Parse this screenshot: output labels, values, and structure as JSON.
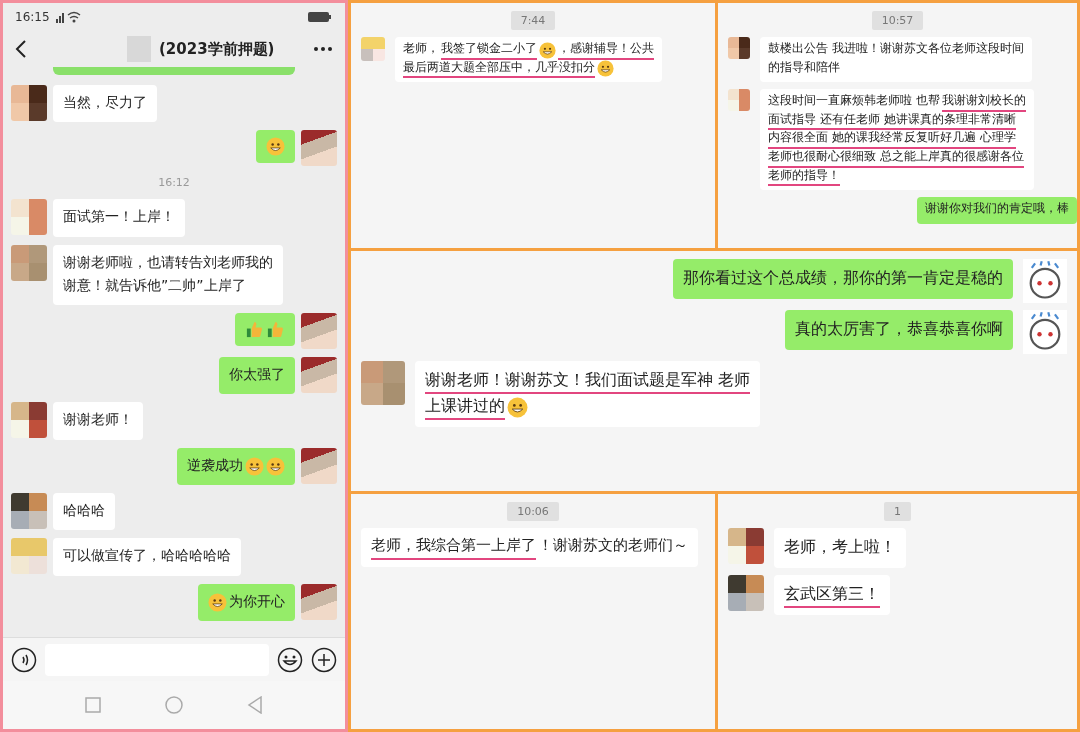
{
  "phone": {
    "status_time": "16:15",
    "title": "(2023学前押题)",
    "messages": [
      {
        "kind": "in",
        "lines": [
          [
            {
              "kind": "text",
              "text": "当然，尽力了",
              "underlined": false
            }
          ]
        ]
      },
      {
        "kind": "out",
        "lines": [
          [
            {
              "kind": "emoji"
            }
          ]
        ]
      },
      {
        "kind": "time",
        "text": "16:12"
      },
      {
        "kind": "in",
        "lines": [
          [
            {
              "kind": "text",
              "text": "面试第一！上岸！",
              "underlined": false
            }
          ]
        ]
      },
      {
        "kind": "in",
        "lines": [
          [
            {
              "kind": "text",
              "text": "谢谢老师啦，也请转告刘老师我的",
              "underlined": false
            }
          ],
          [
            {
              "kind": "text",
              "text": "谢意！就告诉他”二帅”上岸了",
              "underlined": false
            }
          ]
        ]
      },
      {
        "kind": "out",
        "lines": [
          [
            {
              "kind": "thumb"
            },
            {
              "kind": "thumb"
            }
          ]
        ]
      },
      {
        "kind": "out",
        "lines": [
          [
            {
              "kind": "text",
              "text": "你太强了",
              "underlined": false
            }
          ]
        ]
      },
      {
        "kind": "in",
        "lines": [
          [
            {
              "kind": "text",
              "text": "谢谢老师！",
              "underlined": false
            }
          ]
        ]
      },
      {
        "kind": "out",
        "lines": [
          [
            {
              "kind": "text",
              "text": "逆袭成功",
              "underlined": false
            },
            {
              "kind": "emoji"
            },
            {
              "kind": "emoji"
            }
          ]
        ]
      },
      {
        "kind": "in",
        "lines": [
          [
            {
              "kind": "text",
              "text": "哈哈哈",
              "underlined": false
            }
          ]
        ]
      },
      {
        "kind": "in",
        "lines": [
          [
            {
              "kind": "text",
              "text": "可以做宣传了，哈哈哈哈哈",
              "underlined": false
            }
          ]
        ]
      },
      {
        "kind": "out",
        "lines": [
          [
            {
              "kind": "emoji"
            },
            {
              "kind": "text",
              "text": "为你开心",
              "underlined": false
            }
          ]
        ]
      }
    ]
  },
  "panels": [
    {
      "time": "7:44",
      "messages": [
        {
          "kind": "in",
          "avatar": true,
          "lines": [
            [
              {
                "kind": "text",
                "text": "老师，",
                "underlined": false
              },
              {
                "kind": "text",
                "text": "我签了锁金二小了",
                "underlined": true
              },
              {
                "kind": "emoji"
              },
              {
                "kind": "text",
                "text": "，感谢辅导！公共",
                "underlined": true
              }
            ],
            [
              {
                "kind": "text",
                "text": "最后两道大题全部压中，几乎没扣分",
                "underlined": true
              },
              {
                "kind": "emoji"
              }
            ]
          ]
        }
      ]
    },
    {
      "time": "10:57",
      "messages": [
        {
          "kind": "in",
          "avatar": true,
          "lines": [
            [
              {
                "kind": "text",
                "text": "鼓楼出公告 我进啦！谢谢苏文各位老师这段时间",
                "underlined": false
              }
            ],
            [
              {
                "kind": "text",
                "text": "的指导和陪伴",
                "underlined": false
              }
            ]
          ]
        },
        {
          "kind": "in",
          "avatar": true,
          "lines": [
            [
              {
                "kind": "text",
                "text": "这段时间一直麻烦韩老师啦 也帮",
                "underlined": false
              },
              {
                "kind": "text",
                "text": "我谢谢刘校长的",
                "underlined": true
              }
            ],
            [
              {
                "kind": "text",
                "text": "面试指导 还有任老师 她讲课真的条理非常清晰",
                "underlined": true
              }
            ],
            [
              {
                "kind": "text",
                "text": "内容很全面 她的课我经常反复听好几遍 心理学",
                "underlined": true
              }
            ],
            [
              {
                "kind": "text",
                "text": "老师也很耐心很细致 总之能上岸真的很感谢各位",
                "underlined": true
              }
            ],
            [
              {
                "kind": "text",
                "text": "老师的指导！",
                "underlined": true
              }
            ]
          ]
        },
        {
          "kind": "out",
          "avatar": false,
          "lines": [
            [
              {
                "kind": "text",
                "text": "谢谢你对我们的肯定哦，棒",
                "underlined": false
              }
            ]
          ]
        }
      ]
    },
    {
      "messages": [
        {
          "kind": "out",
          "avatar": true,
          "lines": [
            [
              {
                "kind": "text",
                "text": "那你看过这个总成绩，那你的第一肯定是稳的",
                "underlined": false
              }
            ]
          ]
        },
        {
          "kind": "out",
          "avatar": true,
          "lines": [
            [
              {
                "kind": "text",
                "text": "真的太厉害了，恭喜恭喜你啊",
                "underlined": false
              }
            ]
          ]
        },
        {
          "kind": "in",
          "avatar": true,
          "lines": [
            [
              {
                "kind": "text",
                "text": "谢谢老师！谢谢苏文！我们面试题是军神 老师",
                "underlined": true
              }
            ],
            [
              {
                "kind": "text",
                "text": "上课讲过的",
                "underlined": true
              },
              {
                "kind": "emoji"
              }
            ]
          ]
        }
      ]
    },
    {
      "time": "10:06",
      "messages": [
        {
          "kind": "in",
          "avatar": false,
          "lines": [
            [
              {
                "kind": "text",
                "text": "老师，我综合第一上岸了",
                "underlined": true
              },
              {
                "kind": "text",
                "text": "！谢谢苏文的老师们～",
                "underlined": false
              }
            ]
          ]
        }
      ]
    },
    {
      "time": "1",
      "messages": [
        {
          "kind": "in",
          "avatar": true,
          "lines": [
            [
              {
                "kind": "text",
                "text": "老师，考上啦！",
                "underlined": false
              }
            ]
          ]
        },
        {
          "kind": "in",
          "avatar": true,
          "lines": [
            [
              {
                "kind": "text",
                "text": "玄武区第三！",
                "underlined": true
              }
            ]
          ]
        }
      ]
    }
  ]
}
